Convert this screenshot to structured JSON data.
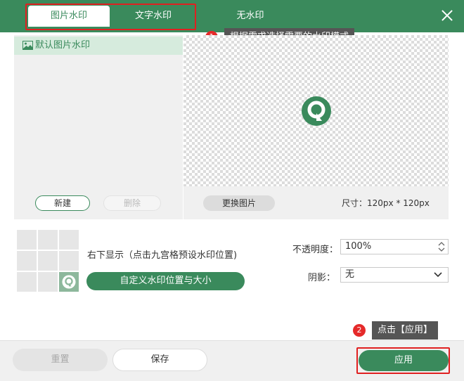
{
  "tabs": [
    {
      "label": "图片水印",
      "active": true
    },
    {
      "label": "文字水印",
      "active": false
    },
    {
      "label": "无水印",
      "active": false
    }
  ],
  "callouts": [
    {
      "number": "1",
      "text": "根据需求选择需要的水印模式"
    },
    {
      "number": "2",
      "text": "点击【应用】"
    }
  ],
  "left_panel": {
    "list_items": [
      "默认图片水印"
    ],
    "new_label": "新建",
    "delete_label": "删除"
  },
  "preview": {
    "replace_label": "更换图片",
    "size_text": "尺寸：120px * 120px"
  },
  "position": {
    "text": "右下显示（点击九宫格预设水印位置)",
    "custom_label": "自定义水印位置与大小",
    "selected_cell": 9
  },
  "settings": {
    "opacity_label": "不透明度：",
    "opacity_value": "100%",
    "shadow_label": "阴影：",
    "shadow_value": "无"
  },
  "footer": {
    "reset_label": "重置",
    "save_label": "保存",
    "apply_label": "应用"
  },
  "colors": {
    "accent": "#3a8a5c",
    "highlight": "#e02020",
    "badge": "#e52a2a"
  },
  "icons": [
    "close-icon",
    "image-icon",
    "watermark-logo-icon",
    "spin-arrows-icon",
    "chevron-down-icon"
  ]
}
